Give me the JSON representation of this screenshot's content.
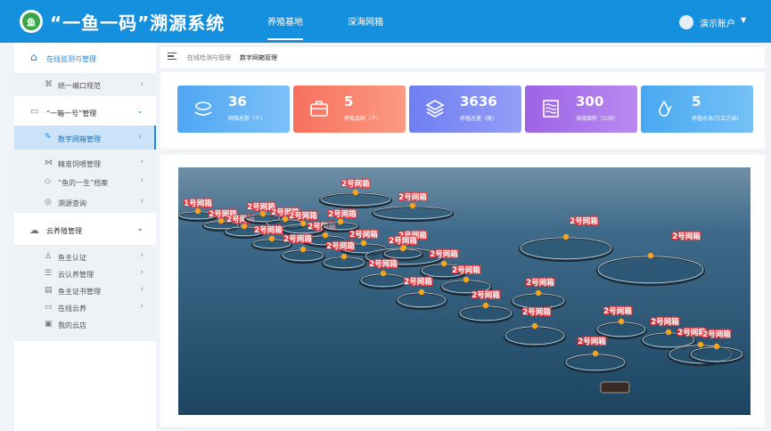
{
  "app": {
    "title": "“一鱼一码”溯源系统",
    "logo_text": "鱼"
  },
  "topnav": {
    "tabs": [
      {
        "label": "养殖基地",
        "active": true
      },
      {
        "label": "深海网箱",
        "active": false
      }
    ]
  },
  "user": {
    "name": "演示账户",
    "caret": "▼"
  },
  "sidebar": {
    "sections": [
      {
        "label": "在线监测与管理",
        "icon": "home-icon",
        "active": true
      },
      {
        "label": "“一箱一号”管理",
        "icon": "box-icon"
      },
      {
        "label": "云养殖管理",
        "icon": "cloud-icon"
      }
    ],
    "items": [
      {
        "label": "统一编口规范",
        "icon": "sitemap-icon"
      },
      {
        "label": "数字网箱管理",
        "icon": "edit-icon",
        "active": true
      },
      {
        "label": "精准饲喂管理",
        "icon": "fish-icon"
      },
      {
        "label": "“鱼的一生”档案",
        "icon": "tag-icon"
      },
      {
        "label": "溯源查询",
        "icon": "search-icon"
      },
      {
        "label": "鱼主认证",
        "icon": "user-icon"
      },
      {
        "label": "云认养管理",
        "icon": "list-icon"
      },
      {
        "label": "鱼主证书管理",
        "icon": "certificate-icon"
      },
      {
        "label": "在线云养",
        "icon": "monitor-icon"
      },
      {
        "label": "我的云店",
        "icon": "store-icon"
      }
    ]
  },
  "breadcrumb": {
    "parent": "在线检测与管理",
    "current": "数字网箱管理"
  },
  "stats": [
    {
      "value": "36",
      "caption": "网箱总数（个）",
      "color": "#4fa7f2",
      "icon": "fish-hand-icon"
    },
    {
      "value": "5",
      "caption": "养殖品种（个）",
      "color": "#f7715d",
      "icon": "briefcase-icon"
    },
    {
      "value": "3636",
      "caption": "养殖总量（尾）",
      "color": "#6f7ef2",
      "icon": "layers-icon"
    },
    {
      "value": "300",
      "caption": "海域面积（公顷）",
      "color": "#9d63e6",
      "icon": "waves-icon"
    },
    {
      "value": "5",
      "caption": "养殖水体(万立方米)",
      "color": "#48a8f0",
      "icon": "water-drop-icon"
    }
  ],
  "cages": [
    {
      "label": "2号网箱"
    },
    {
      "label": "2号网箱"
    },
    {
      "label": "1号网箱"
    },
    {
      "label": "2号网箱"
    },
    {
      "label": "2号网箱"
    },
    {
      "label": "2号网箱"
    },
    {
      "label": "2号网箱"
    },
    {
      "label": "2号网箱"
    },
    {
      "label": "2号网箱"
    },
    {
      "label": "2号网箱"
    },
    {
      "label": "2号网箱"
    },
    {
      "label": "2号网箱"
    },
    {
      "label": "2号网箱"
    },
    {
      "label": "2号网箱"
    },
    {
      "label": "2号网箱"
    },
    {
      "label": "2号网箱"
    },
    {
      "label": "2号网箱"
    },
    {
      "label": "2号网箱"
    },
    {
      "label": "2号网箱"
    },
    {
      "label": "2号网箱"
    },
    {
      "label": "2号网箱"
    },
    {
      "label": "2号网箱"
    },
    {
      "label": "2号网箱"
    },
    {
      "label": "2号网箱"
    },
    {
      "label": "2号网箱"
    },
    {
      "label": "2号网箱"
    },
    {
      "label": "2号网箱"
    },
    {
      "label": "2号网箱"
    },
    {
      "label": "2号网箱"
    },
    {
      "label": "2号网箱"
    }
  ]
}
